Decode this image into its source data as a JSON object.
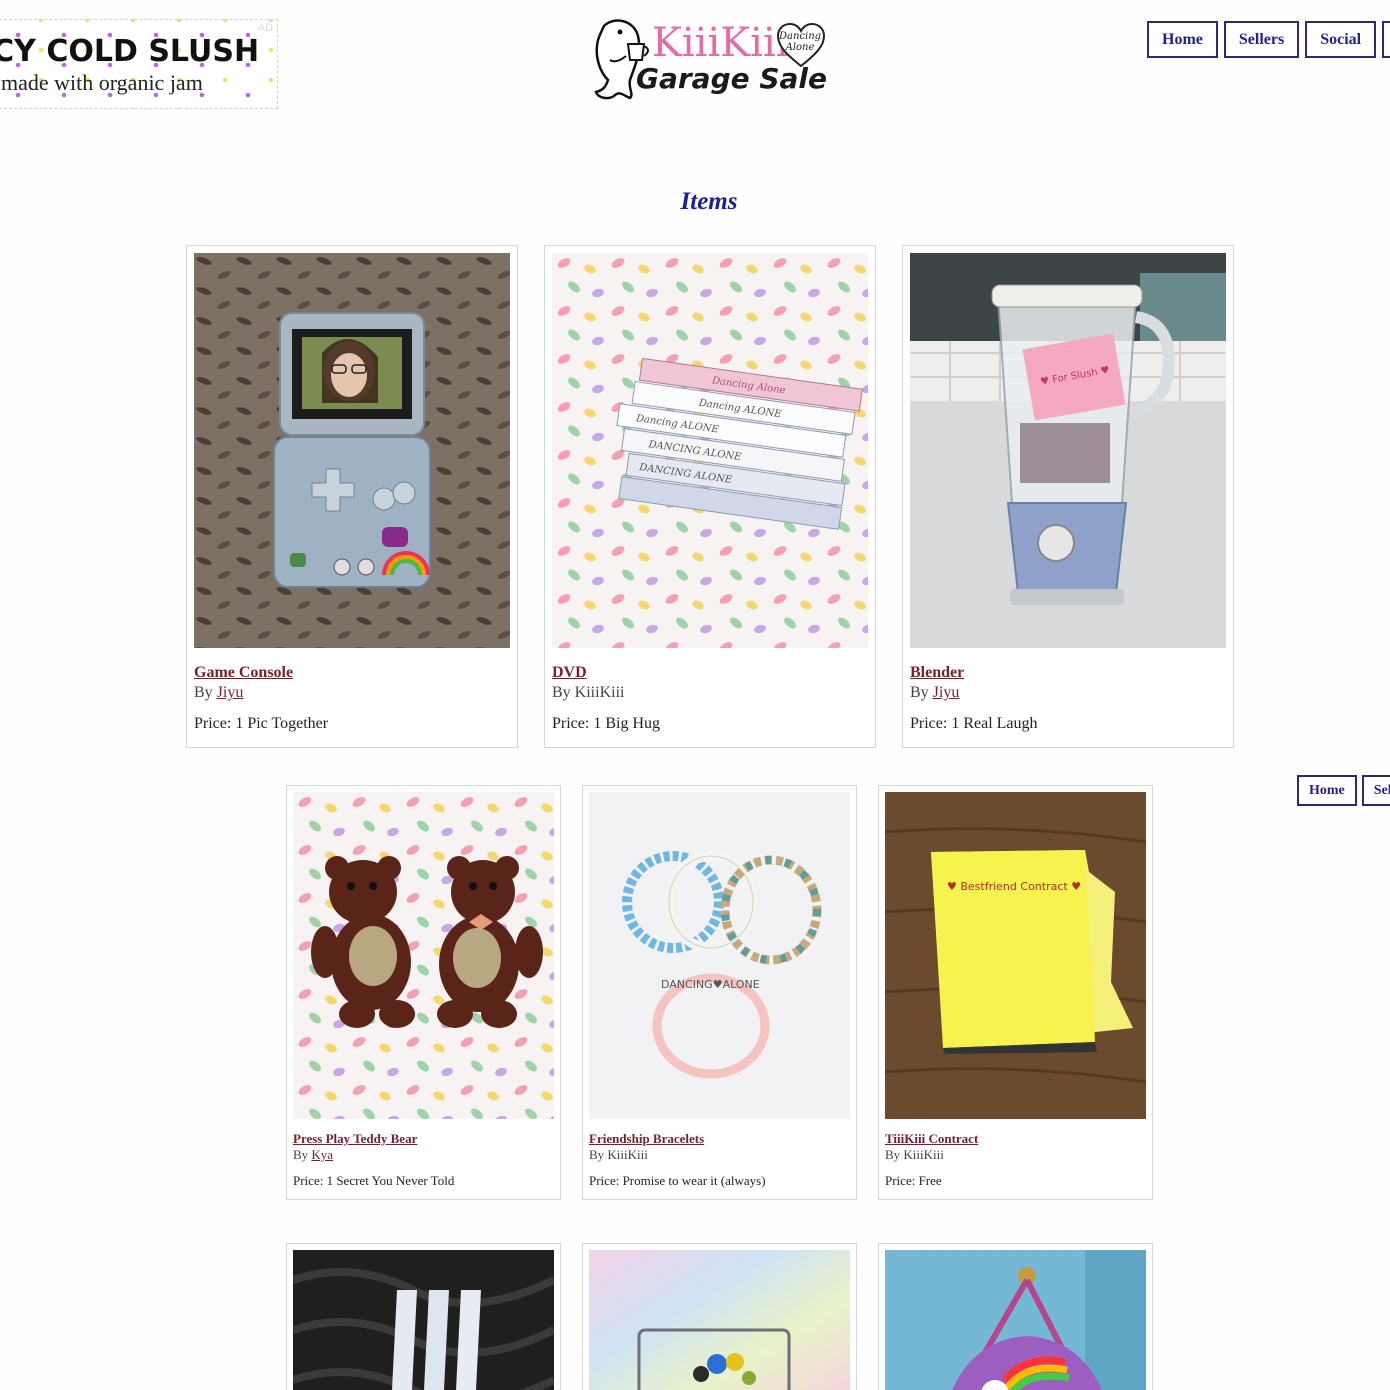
{
  "ad": {
    "tag": "AD",
    "title": "ICY COLD SLUSH",
    "subtitle": "made with organic jam"
  },
  "logo": {
    "title": "KiiiKiii",
    "subtitle": "Garage Sale",
    "heart_line1": "Dancing",
    "heart_line2": "Alone"
  },
  "nav": {
    "home": "Home",
    "sellers": "Sellers",
    "social": "Social"
  },
  "nav_secondary": {
    "home": "Home",
    "sellers": "Sel"
  },
  "heading": "Items",
  "by_prefix": "By",
  "items": [
    {
      "name": "Game Console",
      "seller": "Jiyu",
      "seller_link": true,
      "price": "Price: 1 Pic Together"
    },
    {
      "name": "DVD",
      "seller": "KiiiKiii",
      "seller_link": false,
      "price": "Price: 1 Big Hug"
    },
    {
      "name": "Blender",
      "seller": "Jiyu",
      "seller_link": true,
      "price": "Price: 1 Real Laugh"
    },
    {
      "name": "Press Play Teddy Bear",
      "seller": "Kya",
      "seller_link": true,
      "price": "Price: 1 Secret You Never Told"
    },
    {
      "name": "Friendship Bracelets",
      "seller": "KiiiKiii",
      "seller_link": false,
      "price": "Price: Promise to wear it (always)"
    },
    {
      "name": "TiiiKiii Contract",
      "seller": "KiiiKiii",
      "seller_link": false,
      "price": "Price: Free"
    }
  ],
  "photo_text": {
    "dvd_spine_1": "Dancing Alone",
    "dvd_spine_2": "Dancing ALONE",
    "dvd_spine_3": "Dancing ALONE",
    "dvd_spine_4": "DANCING ALONE",
    "dvd_spine_5": "DANCING ALONE",
    "sticky_note": "♥ For Slush ♥",
    "bracelet_letters": "DANCING♥ALONE",
    "contract_label": "♥ Bestfriend Contract ♥"
  },
  "colors": {
    "accent_blue": "#23238e",
    "link_red": "#7a1f2a",
    "logo_pink": "#e66aa6"
  }
}
